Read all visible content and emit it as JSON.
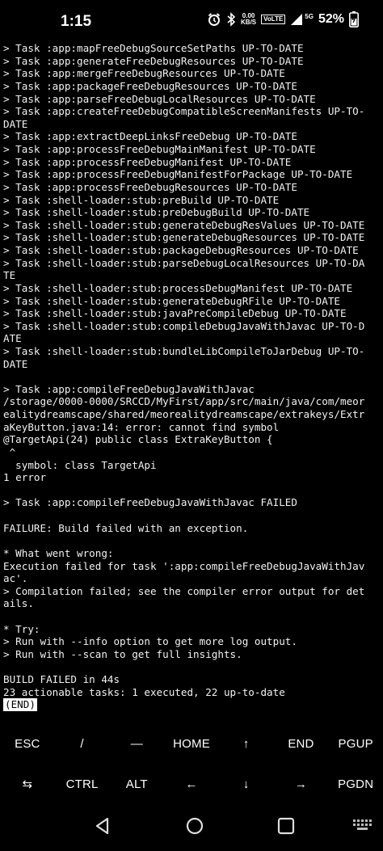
{
  "status_bar": {
    "time": "1:15",
    "data_rate": "0.00",
    "data_unit": "KB/S",
    "volte": "VoLTE",
    "network": "5G",
    "battery": "52%",
    "icons": [
      "alarm-icon",
      "bluetooth-icon",
      "signal-icon",
      "battery-icon"
    ]
  },
  "terminal": {
    "lines": [
      "> Task :app:mapFreeDebugSourceSetPaths UP-TO-DATE",
      "> Task :app:generateFreeDebugResources UP-TO-DATE",
      "> Task :app:mergeFreeDebugResources UP-TO-DATE",
      "> Task :app:packageFreeDebugResources UP-TO-DATE",
      "> Task :app:parseFreeDebugLocalResources UP-TO-DATE",
      "> Task :app:createFreeDebugCompatibleScreenManifests UP-TO-",
      "DATE",
      "> Task :app:extractDeepLinksFreeDebug UP-TO-DATE",
      "> Task :app:processFreeDebugMainManifest UP-TO-DATE",
      "> Task :app:processFreeDebugManifest UP-TO-DATE",
      "> Task :app:processFreeDebugManifestForPackage UP-TO-DATE",
      "> Task :app:processFreeDebugResources UP-TO-DATE",
      "> Task :shell-loader:stub:preBuild UP-TO-DATE",
      "> Task :shell-loader:stub:preDebugBuild UP-TO-DATE",
      "> Task :shell-loader:stub:generateDebugResValues UP-TO-DATE",
      "> Task :shell-loader:stub:generateDebugResources UP-TO-DATE",
      "> Task :shell-loader:stub:packageDebugResources UP-TO-DATE",
      "> Task :shell-loader:stub:parseDebugLocalResources UP-TO-DA",
      "TE",
      "> Task :shell-loader:stub:processDebugManifest UP-TO-DATE",
      "> Task :shell-loader:stub:generateDebugRFile UP-TO-DATE",
      "> Task :shell-loader:stub:javaPreCompileDebug UP-TO-DATE",
      "> Task :shell-loader:stub:compileDebugJavaWithJavac UP-TO-D",
      "ATE",
      "> Task :shell-loader:stub:bundleLibCompileToJarDebug UP-TO-",
      "DATE",
      "",
      "> Task :app:compileFreeDebugJavaWithJavac",
      "/storage/0000-0000/SRCCD/MyFirst/app/src/main/java/com/meor",
      "ealitydreamscape/shared/meorealitydreamscape/extrakeys/Extr",
      "aKeyButton.java:14: error: cannot find symbol",
      "@TargetApi(24) public class ExtraKeyButton {",
      " ^",
      "  symbol: class TargetApi",
      "1 error",
      "",
      "> Task :app:compileFreeDebugJavaWithJavac FAILED",
      "",
      "FAILURE: Build failed with an exception.",
      "",
      "* What went wrong:",
      "Execution failed for task ':app:compileFreeDebugJavaWithJav",
      "ac'.",
      "> Compilation failed; see the compiler error output for det",
      "ails.",
      "",
      "* Try:",
      "> Run with --info option to get more log output.",
      "> Run with --scan to get full insights.",
      "",
      "BUILD FAILED in 44s",
      "23 actionable tasks: 1 executed, 22 up-to-date"
    ],
    "end_marker": "(END)"
  },
  "extra_keys": {
    "row1": [
      "ESC",
      "/",
      "—",
      "HOME",
      "↑",
      "END",
      "PGUP"
    ],
    "row2": [
      "⇆",
      "CTRL",
      "ALT",
      "←",
      "↓",
      "→",
      "PGDN"
    ]
  },
  "nav_bar": {
    "buttons": [
      "back-icon",
      "home-icon",
      "recents-icon",
      "keyboard-icon"
    ]
  }
}
